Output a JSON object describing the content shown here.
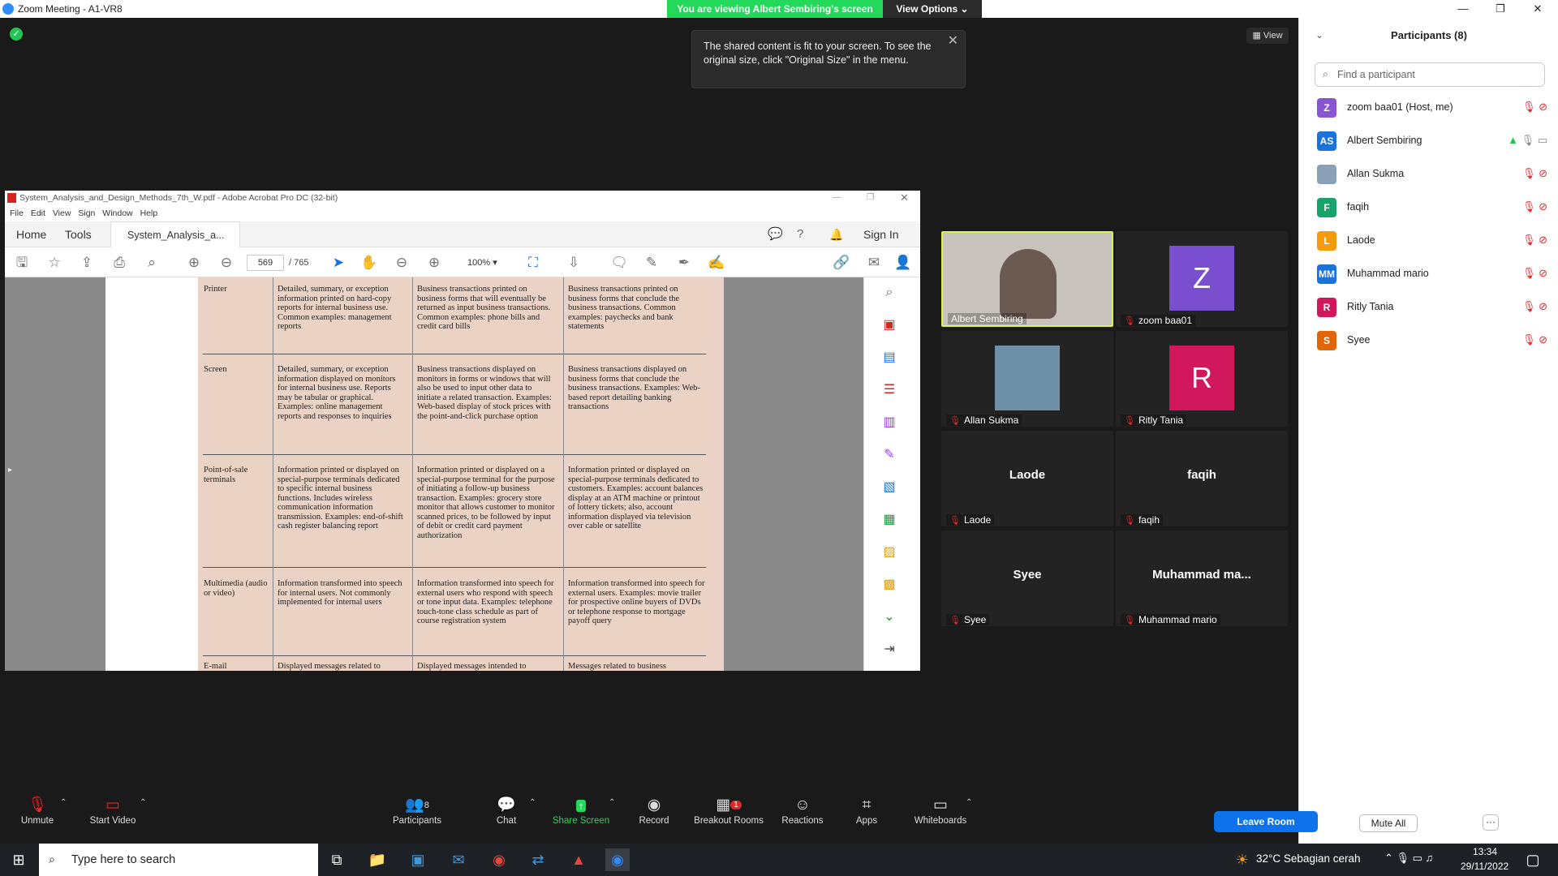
{
  "window": {
    "title": "Zoom Meeting - A1-VR8"
  },
  "banner": {
    "viewing": "You are viewing Albert Sembiring's screen",
    "view_options": "View Options"
  },
  "tooltip": {
    "text_line1": "The shared content is fit to your screen. To see the",
    "text_line2": "original size, click \"Original Size\" in the menu."
  },
  "view_button": "View",
  "acrobat": {
    "title": "System_Analysis_and_Design_Methods_7th_W.pdf - Adobe Acrobat Pro DC (32-bit)",
    "menu": [
      "File",
      "Edit",
      "View",
      "Sign",
      "Window",
      "Help"
    ],
    "tabs": {
      "home": "Home",
      "tools": "Tools",
      "doc": "System_Analysis_a..."
    },
    "sign_in": "Sign In",
    "page_current": "569",
    "page_total": "/ 765",
    "zoom": "100%",
    "table": [
      {
        "type": "Printer",
        "c1": "Detailed, summary, or exception information printed on hard-copy reports for internal business use. Common examples: management reports",
        "c2": "Business transactions printed on business forms that will eventually be returned as input business transactions. Common examples: phone bills and credit card bills",
        "c3": "Business transactions printed on business forms that conclude the business transactions. Common examples: paychecks and bank statements"
      },
      {
        "type": "Screen",
        "c1": "Detailed, summary, or exception information displayed on monitors for internal business use. Reports may be tabular or graphical. Examples: online management reports and responses to inquiries",
        "c2": "Business transactions displayed on monitors in forms or windows that will also be used to input other data to initiate a related transaction. Examples: Web-based display of stock prices with the point-and-click purchase option",
        "c3": "Business transactions displayed on business forms that conclude the business transactions. Examples: Web-based report detailing banking transactions"
      },
      {
        "type": "Point-of-sale terminals",
        "c1": "Information printed or displayed on special-purpose terminals dedicated to specific internal business functions. Includes wireless communication information transmission. Examples: end-of-shift cash register balancing report",
        "c2": "Information printed or displayed on a special-purpose terminal for the purpose of initiating a follow-up business transaction. Examples: grocery store monitor that allows customer to monitor scanned prices, to be followed by input of debit or credit card payment authorization",
        "c3": "Information printed or displayed on special-purpose terminals dedicated to customers. Examples: account balances display at an ATM machine or printout of lottery tickets; also, account information displayed via television over cable or satellite"
      },
      {
        "type": "Multimedia (audio or video)",
        "c1": "Information transformed into speech for internal users. Not commonly implemented for internal users",
        "c2": "Information transformed into speech for external users who respond with speech or tone input data. Examples: telephone touch-tone class schedule as part of course registration system",
        "c3": "Information transformed into speech for external users. Examples: movie trailer for prospective online buyers of DVDs or telephone response to mortgage payoff query"
      },
      {
        "type": "E-mail",
        "c1": "Displayed messages related to",
        "c2": "Displayed messages intended to",
        "c3": "Messages related to business"
      }
    ]
  },
  "tiles": [
    {
      "name": "Albert Sembiring",
      "kind": "video"
    },
    {
      "name": "zoom baa01",
      "kind": "avatar",
      "letter": "Z",
      "color": "#7a4fcf"
    },
    {
      "name": "Allan Sukma",
      "kind": "photo"
    },
    {
      "name": "Ritly Tania",
      "kind": "avatar",
      "letter": "R",
      "color": "#d2185c"
    },
    {
      "name": "Laode",
      "kind": "text",
      "big": "Laode"
    },
    {
      "name": "faqih",
      "kind": "text",
      "big": "faqih"
    },
    {
      "name": "Syee",
      "kind": "text",
      "big": "Syee"
    },
    {
      "name": "Muhammad mario",
      "kind": "text",
      "big": "Muhammad  ma..."
    }
  ],
  "participants": {
    "header": "Participants (8)",
    "search_placeholder": "Find a participant",
    "list": [
      {
        "initials": "Z",
        "name": "zoom baa01 (Host, me)",
        "color": "#8a55d0"
      },
      {
        "initials": "AS",
        "name": "Albert Sembiring",
        "color": "#1b73d9"
      },
      {
        "initials": "",
        "name": "Allan Sukma",
        "color": "#8aa0b8"
      },
      {
        "initials": "F",
        "name": "faqih",
        "color": "#18a36b"
      },
      {
        "initials": "L",
        "name": "Laode",
        "color": "#f59a0b"
      },
      {
        "initials": "MM",
        "name": "Muhammad mario",
        "color": "#1b73d9"
      },
      {
        "initials": "R",
        "name": "Ritly Tania",
        "color": "#d2185c"
      },
      {
        "initials": "S",
        "name": "Syee",
        "color": "#e0650b"
      }
    ],
    "mute_all": "Mute All",
    "more": "···"
  },
  "toolbar": {
    "unmute": "Unmute",
    "start_video": "Start Video",
    "participants": "Participants",
    "participants_count": "8",
    "chat": "Chat",
    "share_screen": "Share Screen",
    "record": "Record",
    "breakout": "Breakout Rooms",
    "breakout_badge": "1",
    "reactions": "Reactions",
    "apps": "Apps",
    "whiteboards": "Whiteboards",
    "leave": "Leave Room"
  },
  "taskbar": {
    "search": "Type here to search",
    "weather": "32°C  Sebagian cerah",
    "time": "13:34",
    "date": "29/11/2022"
  },
  "colors": {
    "accent": "#2D8CFF",
    "green": "#23d959",
    "mute_red": "#e02828",
    "leave_blue": "#0e72ed"
  }
}
